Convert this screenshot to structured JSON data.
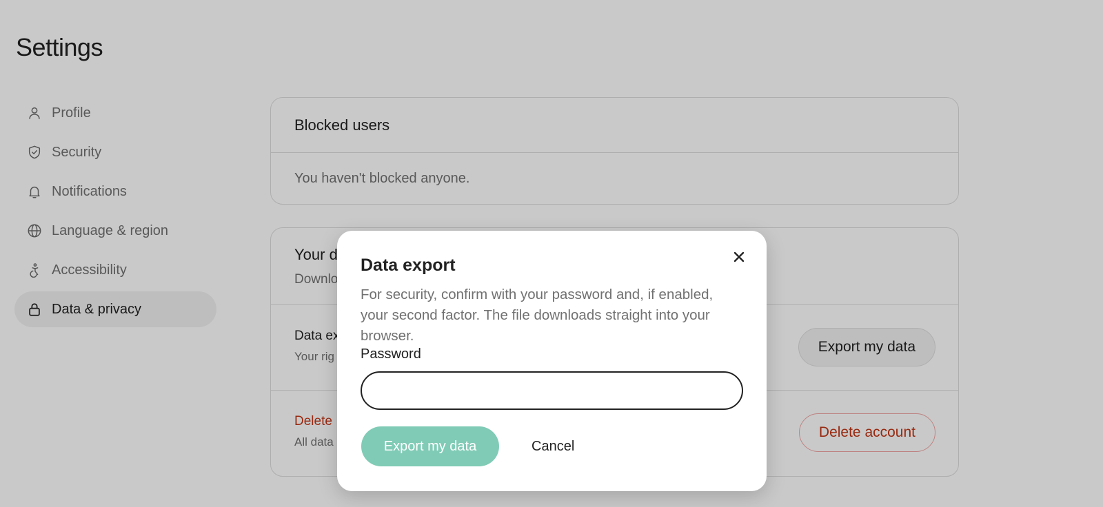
{
  "page": {
    "title": "Settings"
  },
  "sidebar": {
    "items": [
      {
        "label": "Profile",
        "icon": "user-icon",
        "active": false
      },
      {
        "label": "Security",
        "icon": "shield-icon",
        "active": false
      },
      {
        "label": "Notifications",
        "icon": "bell-icon",
        "active": false
      },
      {
        "label": "Language & region",
        "icon": "globe-icon",
        "active": false
      },
      {
        "label": "Accessibility",
        "icon": "accessibility-icon",
        "active": false
      },
      {
        "label": "Data & privacy",
        "icon": "lock-icon",
        "active": true
      }
    ]
  },
  "blocked_users": {
    "title": "Blocked users",
    "empty_text": "You haven't blocked anyone."
  },
  "your_data": {
    "title": "Your d",
    "subtitle": "Downlo",
    "export_row": {
      "title": "Data ex",
      "subtitle": "Your rig",
      "button_label": "Export my data"
    },
    "delete_row": {
      "title": "Delete",
      "subtitle": "All data",
      "button_label": "Delete account"
    }
  },
  "modal": {
    "title": "Data export",
    "description": "For security, confirm with your password and, if enabled, your second factor. The file downloads straight into your browser.",
    "password_label": "Password",
    "password_value": "",
    "primary_button": "Export my data",
    "cancel_button": "Cancel",
    "close_icon": "close-icon"
  },
  "colors": {
    "accent_disabled": "#80cbb5",
    "danger": "#c13515",
    "overlay": "rgba(0,0,0,0.21)"
  }
}
